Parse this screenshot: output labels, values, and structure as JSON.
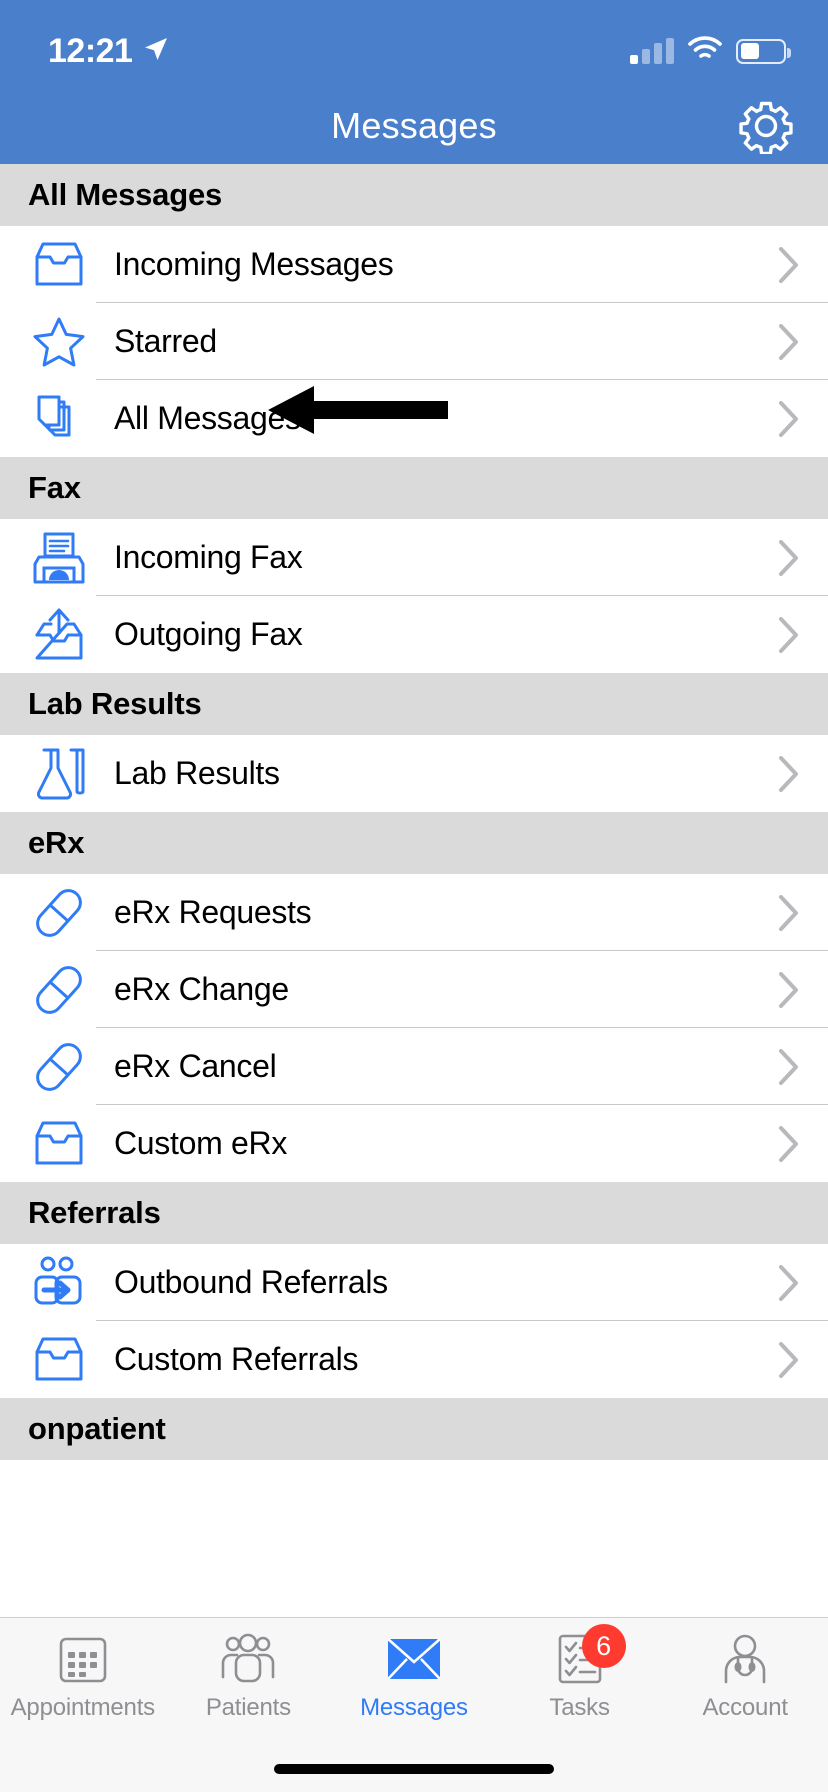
{
  "theme": {
    "brand_blue": "#4a7fcc",
    "icon_blue": "#2f7cf6",
    "section_gray": "#dadada",
    "badge_red": "#ff3b30",
    "inactive_gray": "#8e8e93"
  },
  "status_bar": {
    "time": "12:21",
    "location_icon": "location-arrow-icon",
    "signal_icon": "cellular-signal-icon",
    "wifi_icon": "wifi-icon",
    "battery_icon": "battery-icon",
    "battery_level_percent": 45
  },
  "nav_bar": {
    "title": "Messages",
    "settings_icon": "gear-icon"
  },
  "sections": [
    {
      "title": "All Messages",
      "rows": [
        {
          "label": "Incoming Messages",
          "icon": "inbox-tray-icon"
        },
        {
          "label": "Starred",
          "icon": "star-icon"
        },
        {
          "label": "All Messages",
          "icon": "stacked-pages-icon"
        }
      ]
    },
    {
      "title": "Fax",
      "rows": [
        {
          "label": "Incoming Fax",
          "icon": "fax-machine-icon"
        },
        {
          "label": "Outgoing Fax",
          "icon": "outbox-upload-icon"
        }
      ]
    },
    {
      "title": "Lab Results",
      "rows": [
        {
          "label": "Lab Results",
          "icon": "flask-test-tube-icon"
        }
      ]
    },
    {
      "title": "eRx",
      "rows": [
        {
          "label": "eRx Requests",
          "icon": "pill-capsule-icon"
        },
        {
          "label": "eRx Change",
          "icon": "pill-capsule-icon"
        },
        {
          "label": "eRx Cancel",
          "icon": "pill-capsule-icon"
        },
        {
          "label": "Custom eRx",
          "icon": "inbox-tray-icon"
        }
      ]
    },
    {
      "title": "Referrals",
      "rows": [
        {
          "label": "Outbound Referrals",
          "icon": "people-arrow-icon"
        },
        {
          "label": "Custom Referrals",
          "icon": "inbox-tray-icon"
        }
      ]
    },
    {
      "title": "onpatient",
      "rows": []
    }
  ],
  "annotation": {
    "shape": "left-pointing-arrow",
    "points_to": "All Messages"
  },
  "tab_bar": {
    "tabs": [
      {
        "label": "Appointments",
        "icon": "calendar-icon",
        "active": false,
        "badge": ""
      },
      {
        "label": "Patients",
        "icon": "people-group-icon",
        "active": false,
        "badge": ""
      },
      {
        "label": "Messages",
        "icon": "envelope-icon",
        "active": true,
        "badge": ""
      },
      {
        "label": "Tasks",
        "icon": "checklist-icon",
        "active": false,
        "badge": "6"
      },
      {
        "label": "Account",
        "icon": "doctor-stethoscope-icon",
        "active": false,
        "badge": ""
      }
    ]
  }
}
